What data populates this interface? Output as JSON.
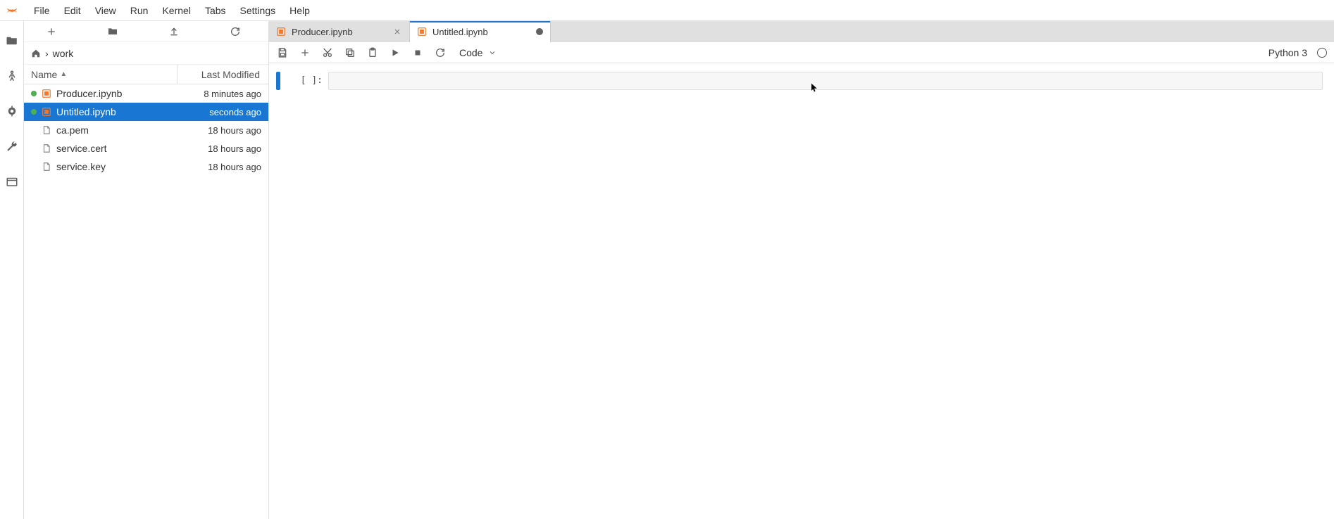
{
  "menu": [
    "File",
    "Edit",
    "View",
    "Run",
    "Kernel",
    "Tabs",
    "Settings",
    "Help"
  ],
  "filebrowser": {
    "breadcrumb": "work",
    "columns": {
      "name": "Name",
      "modified": "Last Modified"
    },
    "files": [
      {
        "name": "Producer.ipynb",
        "modified": "8 minutes ago",
        "running": true,
        "type": "notebook",
        "selected": false
      },
      {
        "name": "Untitled.ipynb",
        "modified": "seconds ago",
        "running": true,
        "type": "notebook",
        "selected": true
      },
      {
        "name": "ca.pem",
        "modified": "18 hours ago",
        "running": false,
        "type": "file",
        "selected": false
      },
      {
        "name": "service.cert",
        "modified": "18 hours ago",
        "running": false,
        "type": "file",
        "selected": false
      },
      {
        "name": "service.key",
        "modified": "18 hours ago",
        "running": false,
        "type": "file",
        "selected": false
      }
    ]
  },
  "tabs": [
    {
      "label": "Producer.ipynb",
      "active": false,
      "dirty": false
    },
    {
      "label": "Untitled.ipynb",
      "active": true,
      "dirty": true
    }
  ],
  "notebook": {
    "cell_type_selected": "Code",
    "kernel": "Python 3",
    "cell_prompt": "[ ]:"
  }
}
